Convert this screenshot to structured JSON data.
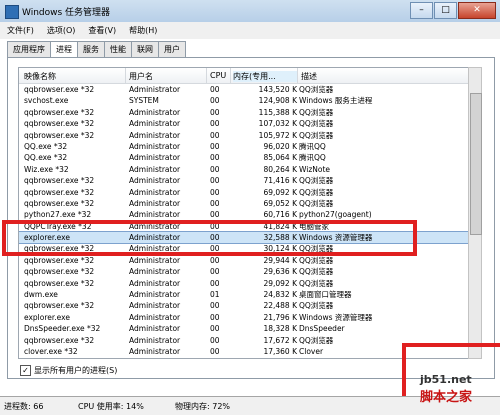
{
  "window": {
    "title": "Windows 任务管理器",
    "min": "–",
    "max": "□",
    "close": "✕"
  },
  "menu": [
    "文件(F)",
    "选项(O)",
    "查看(V)",
    "帮助(H)"
  ],
  "tabs": [
    "应用程序",
    "进程",
    "服务",
    "性能",
    "联网",
    "用户"
  ],
  "active_tab": "进程",
  "columns": [
    "映像名称",
    "用户名",
    "CPU",
    "内存(专用...",
    "描述"
  ],
  "processes": [
    [
      "qqbrowser.exe *32",
      "Administrator",
      "00",
      "143,520 K",
      "QQ浏览器"
    ],
    [
      "svchost.exe",
      "SYSTEM",
      "00",
      "124,908 K",
      "Windows 服务主进程"
    ],
    [
      "qqbrowser.exe *32",
      "Administrator",
      "00",
      "115,388 K",
      "QQ浏览器"
    ],
    [
      "qqbrowser.exe *32",
      "Administrator",
      "00",
      "107,032 K",
      "QQ浏览器"
    ],
    [
      "qqbrowser.exe *32",
      "Administrator",
      "00",
      "105,972 K",
      "QQ浏览器"
    ],
    [
      "QQ.exe *32",
      "Administrator",
      "00",
      "96,020 K",
      "腾讯QQ"
    ],
    [
      "QQ.exe *32",
      "Administrator",
      "00",
      "85,064 K",
      "腾讯QQ"
    ],
    [
      "Wiz.exe *32",
      "Administrator",
      "00",
      "80,264 K",
      "WizNote"
    ],
    [
      "qqbrowser.exe *32",
      "Administrator",
      "00",
      "71,416 K",
      "QQ浏览器"
    ],
    [
      "qqbrowser.exe *32",
      "Administrator",
      "00",
      "69,092 K",
      "QQ浏览器"
    ],
    [
      "qqbrowser.exe *32",
      "Administrator",
      "00",
      "69,052 K",
      "QQ浏览器"
    ],
    [
      "python27.exe *32",
      "Administrator",
      "00",
      "60,716 K",
      "python27(goagent)"
    ],
    [
      "QQPCTray.exe *32",
      "Administrator",
      "00",
      "41,824 K",
      "电脑管家"
    ],
    [
      "explorer.exe",
      "Administrator",
      "00",
      "32,588 K",
      "Windows 资源管理器"
    ],
    [
      "qqbrowser.exe *32",
      "Administrator",
      "00",
      "30,124 K",
      "QQ浏览器"
    ],
    [
      "qqbrowser.exe *32",
      "Administrator",
      "00",
      "29,944 K",
      "QQ浏览器"
    ],
    [
      "qqbrowser.exe *32",
      "Administrator",
      "00",
      "29,636 K",
      "QQ浏览器"
    ],
    [
      "qqbrowser.exe *32",
      "Administrator",
      "00",
      "29,092 K",
      "QQ浏览器"
    ],
    [
      "dwm.exe",
      "Administrator",
      "01",
      "24,832 K",
      "桌面窗口管理器"
    ],
    [
      "qqbrowser.exe *32",
      "Administrator",
      "00",
      "22,488 K",
      "QQ浏览器"
    ],
    [
      "explorer.exe",
      "Administrator",
      "00",
      "21,796 K",
      "Windows 资源管理器"
    ],
    [
      "DnsSpeeder.exe *32",
      "Administrator",
      "00",
      "18,328 K",
      "DnsSpeeder"
    ],
    [
      "qqbrowser.exe *32",
      "Administrator",
      "00",
      "17,672 K",
      "QQ浏览器"
    ],
    [
      "clover.exe *32",
      "Administrator",
      "00",
      "17,360 K",
      "Clover"
    ]
  ],
  "selected_row": 13,
  "show_all_users": "显示所有用户的进程(S)",
  "status": {
    "processes": "进程数: 66",
    "cpu": "CPU 使用率: 14%",
    "memory": "物理内存: 72%"
  },
  "watermark": {
    "site": "jb51.net",
    "name": "脚本之家"
  },
  "colors": {
    "highlight": "#e02020",
    "selection": "#cde4f7"
  }
}
